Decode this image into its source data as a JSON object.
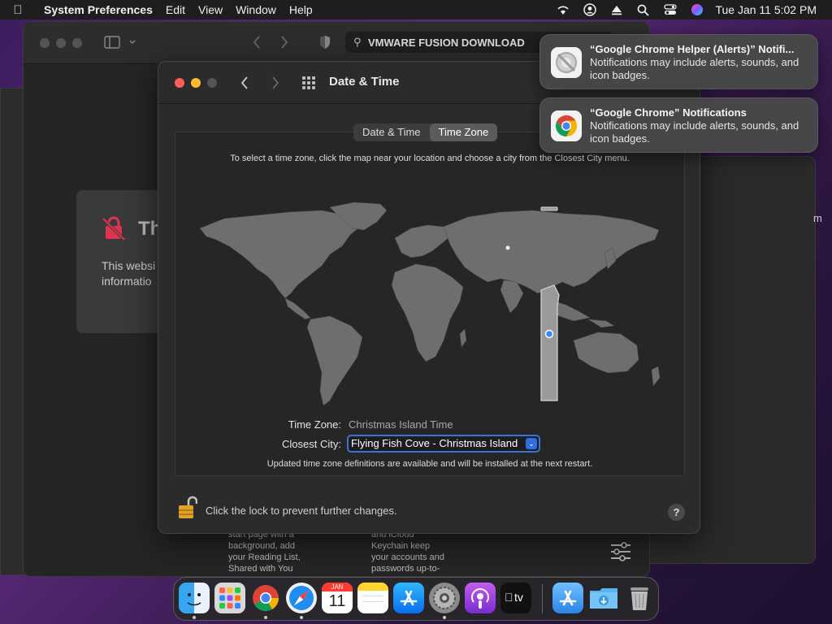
{
  "menubar": {
    "app_name": "System Preferences",
    "items": [
      "Edit",
      "View",
      "Window",
      "Help"
    ],
    "clock": "Tue Jan 11  5:02 PM",
    "status_icons": [
      "wifi-icon",
      "user-icon",
      "airplay-icon",
      "search-icon",
      "control-center-icon",
      "siri-icon"
    ]
  },
  "safari": {
    "url_text": "VMWARE FUSION DOWNLOAD",
    "warning_title": "Th",
    "warning_text_1": "This websi",
    "warning_text_2": "informatio",
    "bottom_left_text": [
      "start page with a",
      "background, add",
      "your Reading List,",
      "Shared with You"
    ],
    "bottom_mid_text": [
      "and iCloud",
      "Keychain keep",
      "your accounts and",
      "passwords up-to-"
    ]
  },
  "right_window": {
    "fragment": "m"
  },
  "prefs": {
    "title": "Date & Time",
    "tabs": [
      {
        "label": "Date & Time",
        "active": false
      },
      {
        "label": "Time Zone",
        "active": true
      }
    ],
    "instructions": "To select a time zone, click the map near your location and choose a city from the Closest City menu.",
    "time_zone_label": "Time Zone:",
    "time_zone_value": "Christmas Island Time",
    "closest_city_label": "Closest City:",
    "closest_city_value": "Flying Fish Cove - Christmas Island",
    "update_note": "Updated time zone definitions are available and will be installed at the next restart.",
    "lock_text": "Click the lock to prevent further changes.",
    "help_label": "?"
  },
  "notifications": [
    {
      "title": "“Google Chrome Helper (Alerts)” Notifi...",
      "body": "Notifications may include alerts, sounds, and icon badges.",
      "icon": "chrome-helper-icon"
    },
    {
      "title": "“Google Chrome” Notifications",
      "body": "Notifications may include alerts, sounds, and icon badges.",
      "icon": "chrome-icon"
    }
  ],
  "dock": {
    "calendar_month": "JAN",
    "calendar_day": "11",
    "tv_label": "tv",
    "apps": [
      "finder-icon",
      "launchpad-icon",
      "chrome-icon",
      "safari-icon",
      "calendar-icon",
      "notes-icon",
      "app-store-icon",
      "system-preferences-icon",
      "podcasts-icon",
      "apple-tv-icon",
      "app-store-folder-icon",
      "downloads-folder-icon",
      "trash-icon"
    ]
  },
  "colors": {
    "accent": "#2f6de0",
    "close": "#ff5f57",
    "minimize": "#febc2e",
    "selected_zone": "#9a9a9a"
  }
}
